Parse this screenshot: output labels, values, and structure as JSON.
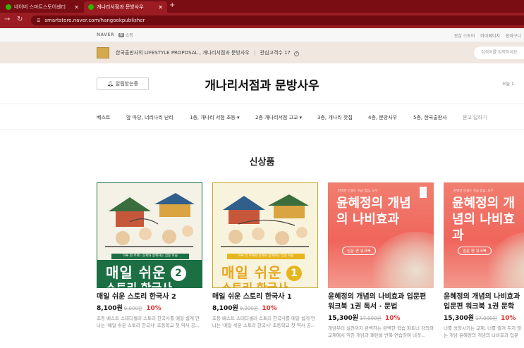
{
  "browser": {
    "tabs": [
      {
        "label": "네이버 스마트스토어센터",
        "active": false
      },
      {
        "label": "개나리서점과 문방사우",
        "active": true
      }
    ],
    "url": "smartstore.naver.com/hangookpublisher"
  },
  "naver_bar": {
    "naver_logo": "NAVER",
    "shopping_badge": "N",
    "shopping_label": "쇼핑",
    "links": [
      "관심 스토어",
      "마이페이지",
      "장바구니"
    ]
  },
  "store_bar": {
    "description": "한국출판사의 LIFESTYLE PROPOSAL , 개나리서점과 문방사우",
    "followers": "관심고객수 17",
    "help": "?",
    "search_placeholder": "검색어를 입력하세요"
  },
  "header": {
    "alarm_label": "알림받는중",
    "title": "개나리서점과 문방사우",
    "today": "오늘 1"
  },
  "categories": [
    {
      "label": "베스트"
    },
    {
      "label": "앞 마당, 너리나리 난리"
    },
    {
      "label": "1층, 개나리 서점 초등 ▾"
    },
    {
      "label": "2층 개나리서점 고교 ▾"
    },
    {
      "label": "3층, 개나리 찻집"
    },
    {
      "label": "4층, 문방사우"
    },
    {
      "label": "5층, 한국출판사"
    },
    {
      "label": "묻고 답하기"
    }
  ],
  "section": {
    "title": "신상품"
  },
  "products": [
    {
      "title": "매일 쉬운 스토리 한국사 2",
      "price": "8,100원",
      "original": "9,000원",
      "discount": "10%",
      "desc": "초등 베스트 스테디셀러 스토리 한국사를 매일 쉽게 만나는 '매일 쉬운 스토리 한국사' 초등학교 첫 역사 공...",
      "cover": {
        "ribbon": "하루 한 주제 · 문제와 함께하는 집중 학습",
        "title1": "매일 쉬운",
        "title2": "스토리 한국사",
        "vol": "2",
        "color": "#1c6e43",
        "vol_color": "#1c6e43"
      }
    },
    {
      "title": "매일 쉬운 스토리 한국사 1",
      "price": "8,100원",
      "original": "9,000원",
      "discount": "10%",
      "desc": "초등 베스트 스테디셀러 스토리 한국사를 매일 쉽게 만나는 '매일 쉬운 스토리 한국사' 초등학교 첫 역사 공...",
      "cover": {
        "ribbon": "하루 한 주제와 문제와 함께하는 집중 학습",
        "title1": "매일 쉬운",
        "title2": "스토리 한국사",
        "vol": "1",
        "color": "#e7b51e",
        "vol_color": "#e7b51e"
      }
    },
    {
      "title": "윤혜정의 개념의 나비효과 입문편 워크북 1권 독서 · 문법",
      "price": "15,300원",
      "original": "17,000원",
      "discount": "10%",
      "desc": "개념부터 실전까지 완벽하는 완벽한 학습 파트너 강의와 교재에서 익힌 개념과 패턴을 반복 연습하며 내것...",
      "cover": {
        "small": "완벽한 인생는 지금 믿음, 모두",
        "title": "윤혜정의 개념의 나비효과",
        "badge": "입문 편 워크북"
      }
    },
    {
      "title": "윤혜정의 개념의 나비효과 입문편 워크북 1권 문학",
      "price": "15,300원",
      "original": "17,000원",
      "discount": "10%",
      "desc": "너를 성장시키는 교재, 너를 즐겨 두지 않는 개념 윤혜정의 개념의 나비효과 입문편! 늘 잘익 역...",
      "cover": {
        "small": "완벽한 인생는 지금 믿음, 모두",
        "title": "윤혜정의 개념의 나비효과",
        "badge": "입문 편 워크북"
      }
    }
  ],
  "colors": {
    "chrome_tabbar": "#7a0d13",
    "chrome_address": "#9b1c22",
    "store_bar": "#efe7e0",
    "discount": "#e0322b"
  }
}
